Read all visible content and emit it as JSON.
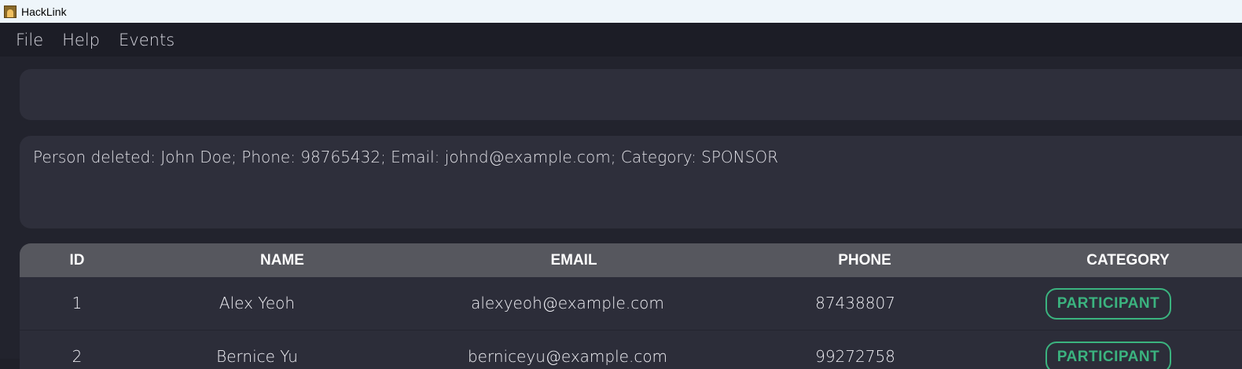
{
  "window": {
    "title": "HackLink"
  },
  "menu": {
    "items": [
      "File",
      "Help",
      "Events"
    ]
  },
  "command": {
    "value": ""
  },
  "result": {
    "text": "Person deleted: John Doe; Phone: 98765432; Email: johnd@example.com; Category: SPONSOR"
  },
  "table": {
    "headers": [
      "ID",
      "NAME",
      "EMAIL",
      "PHONE",
      "CATEGORY"
    ],
    "rows": [
      {
        "id": "1",
        "name": "Alex Yeoh",
        "email": "alexyeoh@example.com",
        "phone": "87438807",
        "category": "PARTICIPANT"
      },
      {
        "id": "2",
        "name": "Bernice Yu",
        "email": "berniceyu@example.com",
        "phone": "99272758",
        "category": "PARTICIPANT"
      }
    ]
  },
  "colors": {
    "category_badge": "#3bb37f",
    "header_bg": "#56575e",
    "panel_bg": "#2e2f3b"
  }
}
